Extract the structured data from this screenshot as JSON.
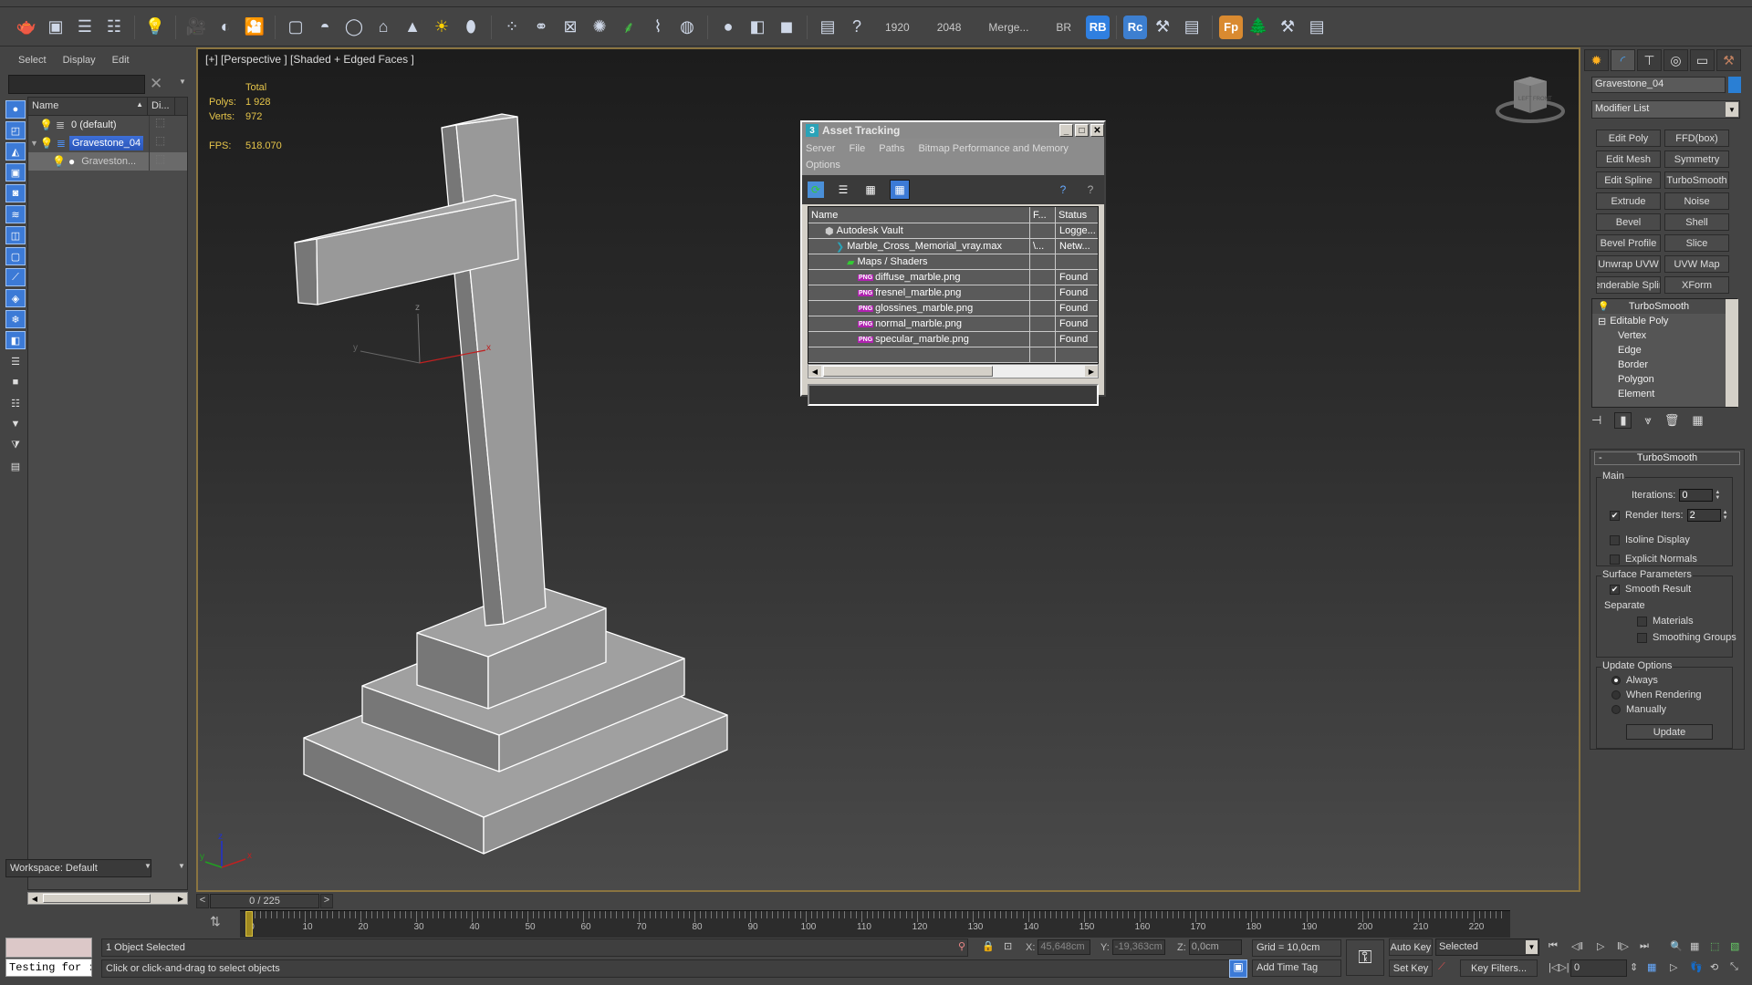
{
  "toolbar": {
    "icons": [
      "teapot-icon",
      "render-frame-icon",
      "render-setup-icon",
      "render-setup-2-icon",
      "light-lister-icon",
      "camera-icon",
      "camera-target-icon",
      "camera-physical-icon",
      "plane-light-icon",
      "sphere-light-icon",
      "disc-light-icon",
      "mesh-light-icon",
      "spot-light-icon",
      "sun-icon",
      "dome-light-icon",
      "particles-icon",
      "molecule-icon",
      "proxy-icon",
      "fur-icon",
      "grass-icon",
      "hair-icon",
      "ox-icon",
      "material-sphere-icon",
      "material-editor-icon",
      "render-region-icon",
      "file-info-icon",
      "help-icon"
    ],
    "texts": [
      "1920",
      "2048",
      "Merge...",
      "BR"
    ],
    "badges": [
      {
        "label": "RB",
        "color": "#2f7fe0"
      },
      {
        "label": "Rc",
        "color": "#3d7fd0"
      },
      {
        "label": "Fp",
        "color": "#d98a30"
      }
    ]
  },
  "explorer": {
    "menus": [
      "Select",
      "Display",
      "Edit"
    ],
    "columns": [
      "Name",
      "Di..."
    ],
    "rows": [
      {
        "label": "0 (default)",
        "type": "layer",
        "selected": false
      },
      {
        "label": "Gravestone_04",
        "type": "layer",
        "selected": true
      },
      {
        "label": "Graveston...",
        "type": "object",
        "selected": false
      }
    ],
    "workspace": "Workspace: Default"
  },
  "viewport": {
    "label": "[+] [Perspective ] [Shaded + Edged Faces ]",
    "stats": {
      "header": "Total",
      "polys_label": "Polys:",
      "polys": "1 928",
      "verts_label": "Verts:",
      "verts": "972",
      "fps_label": "FPS:",
      "fps": "518.070"
    },
    "axis": {
      "x": "x",
      "y": "y",
      "z": "z"
    },
    "viewcube_faces": [
      "LEFT",
      "FRONT"
    ]
  },
  "asset_tracking": {
    "title": "Asset Tracking",
    "menus": [
      "Server",
      "File",
      "Paths",
      "Bitmap Performance and Memory",
      "Options"
    ],
    "columns": [
      "Name",
      "F...",
      "Status"
    ],
    "rows": [
      {
        "name": "Autodesk Vault",
        "f": "",
        "status": "Logge...",
        "indent": 1,
        "icon": "vault-icon"
      },
      {
        "name": "Marble_Cross_Memorial_vray.max",
        "f": "\\...",
        "status": "Netw...",
        "indent": 2,
        "icon": "max-file-icon"
      },
      {
        "name": "Maps / Shaders",
        "f": "",
        "status": "",
        "indent": 3,
        "icon": "maps-icon"
      },
      {
        "name": "diffuse_marble.png",
        "f": "",
        "status": "Found",
        "indent": 4,
        "icon": "png-icon"
      },
      {
        "name": "fresnel_marble.png",
        "f": "",
        "status": "Found",
        "indent": 4,
        "icon": "png-icon"
      },
      {
        "name": "glossines_marble.png",
        "f": "",
        "status": "Found",
        "indent": 4,
        "icon": "png-icon"
      },
      {
        "name": "normal_marble.png",
        "f": "",
        "status": "Found",
        "indent": 4,
        "icon": "png-icon"
      },
      {
        "name": "specular_marble.png",
        "f": "",
        "status": "Found",
        "indent": 4,
        "icon": "png-icon"
      }
    ]
  },
  "command_panel": {
    "object_name": "Gravestone_04",
    "object_color": "#2a7fd4",
    "modifier_list": "Modifier List",
    "modifier_buttons": [
      "Edit Poly",
      "FFD(box)",
      "Edit Mesh",
      "Symmetry",
      "Edit Spline",
      "TurboSmooth",
      "Extrude",
      "Noise",
      "Bevel",
      "Shell",
      "Bevel Profile",
      "Slice",
      "Unwrap UVW",
      "UVW Map",
      "enderable Splir",
      "XForm"
    ],
    "stack": [
      "TurboSmooth",
      "Editable Poly",
      "Vertex",
      "Edge",
      "Border",
      "Polygon",
      "Element"
    ],
    "rollout": {
      "title": "TurboSmooth",
      "main_label": "Main",
      "iterations_label": "Iterations:",
      "iterations": "0",
      "render_iters_label": "Render Iters:",
      "render_iters": "2",
      "render_iters_checked": true,
      "isoline_label": "Isoline Display",
      "isoline_checked": false,
      "explicit_label": "Explicit Normals",
      "explicit_checked": false,
      "surface_label": "Surface Parameters",
      "smooth_label": "Smooth Result",
      "smooth_checked": true,
      "separate_label": "Separate",
      "materials_label": "Materials",
      "materials_checked": false,
      "sgroups_label": "Smoothing Groups",
      "sgroups_checked": false,
      "update_options_label": "Update Options",
      "update_options": [
        "Always",
        "When Rendering",
        "Manually"
      ],
      "update_selected": "Always",
      "update_button": "Update"
    }
  },
  "timeline": {
    "slider": "0 / 225",
    "current_frame": 0,
    "total_frames": 225,
    "tick_labels": [
      0,
      10,
      20,
      30,
      40,
      50,
      60,
      70,
      80,
      90,
      100,
      110,
      120,
      130,
      140,
      150,
      160,
      170,
      180,
      190,
      200,
      210,
      220
    ]
  },
  "status": {
    "script_listener": "Testing for :",
    "selection": "1 Object Selected",
    "prompt": "Click or click-and-drag to select objects",
    "x_label": "X:",
    "x": "45,648cm",
    "y_label": "Y:",
    "y": "-19,363cm",
    "z_label": "Z:",
    "z": "0,0cm",
    "grid": "Grid = 10,0cm",
    "add_time_tag": "Add Time Tag",
    "auto_key": "Auto Key",
    "set_key": "Set Key",
    "key_mode": "Selected",
    "key_filters": "Key Filters...",
    "frame": "0"
  }
}
